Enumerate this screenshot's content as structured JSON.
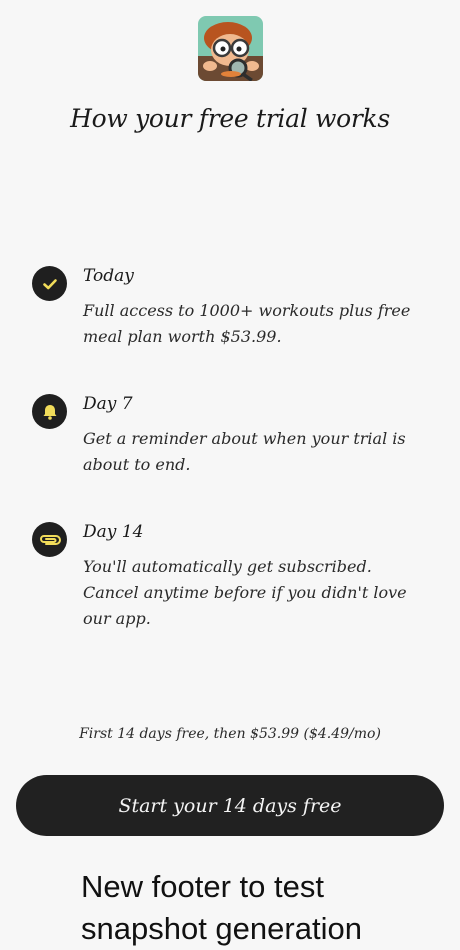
{
  "header": {
    "app_icon": "cartoon-character-with-glasses-and-magnifier",
    "title": "How your free trial works"
  },
  "timeline": [
    {
      "icon": "check-icon",
      "title": "Today",
      "description": "Full access to 1000+ workouts plus free meal plan worth $53.99."
    },
    {
      "icon": "bell-icon",
      "title": "Day 7",
      "description": "Get a reminder about when your trial is about to end."
    },
    {
      "icon": "paperclip-icon",
      "title": "Day 14",
      "description": "You'll automatically get subscribed. Cancel anytime before if you didn't love our app."
    }
  ],
  "pricing_note": "First 14 days free, then $53.99 ($4.49/mo)",
  "cta": {
    "label": "Start your 14 days free"
  },
  "footer": {
    "text": "New footer to test snapshot generation"
  },
  "colors": {
    "background": "#f7f7f7",
    "dark": "#212121",
    "accent_icon": "#f1dc5a"
  }
}
